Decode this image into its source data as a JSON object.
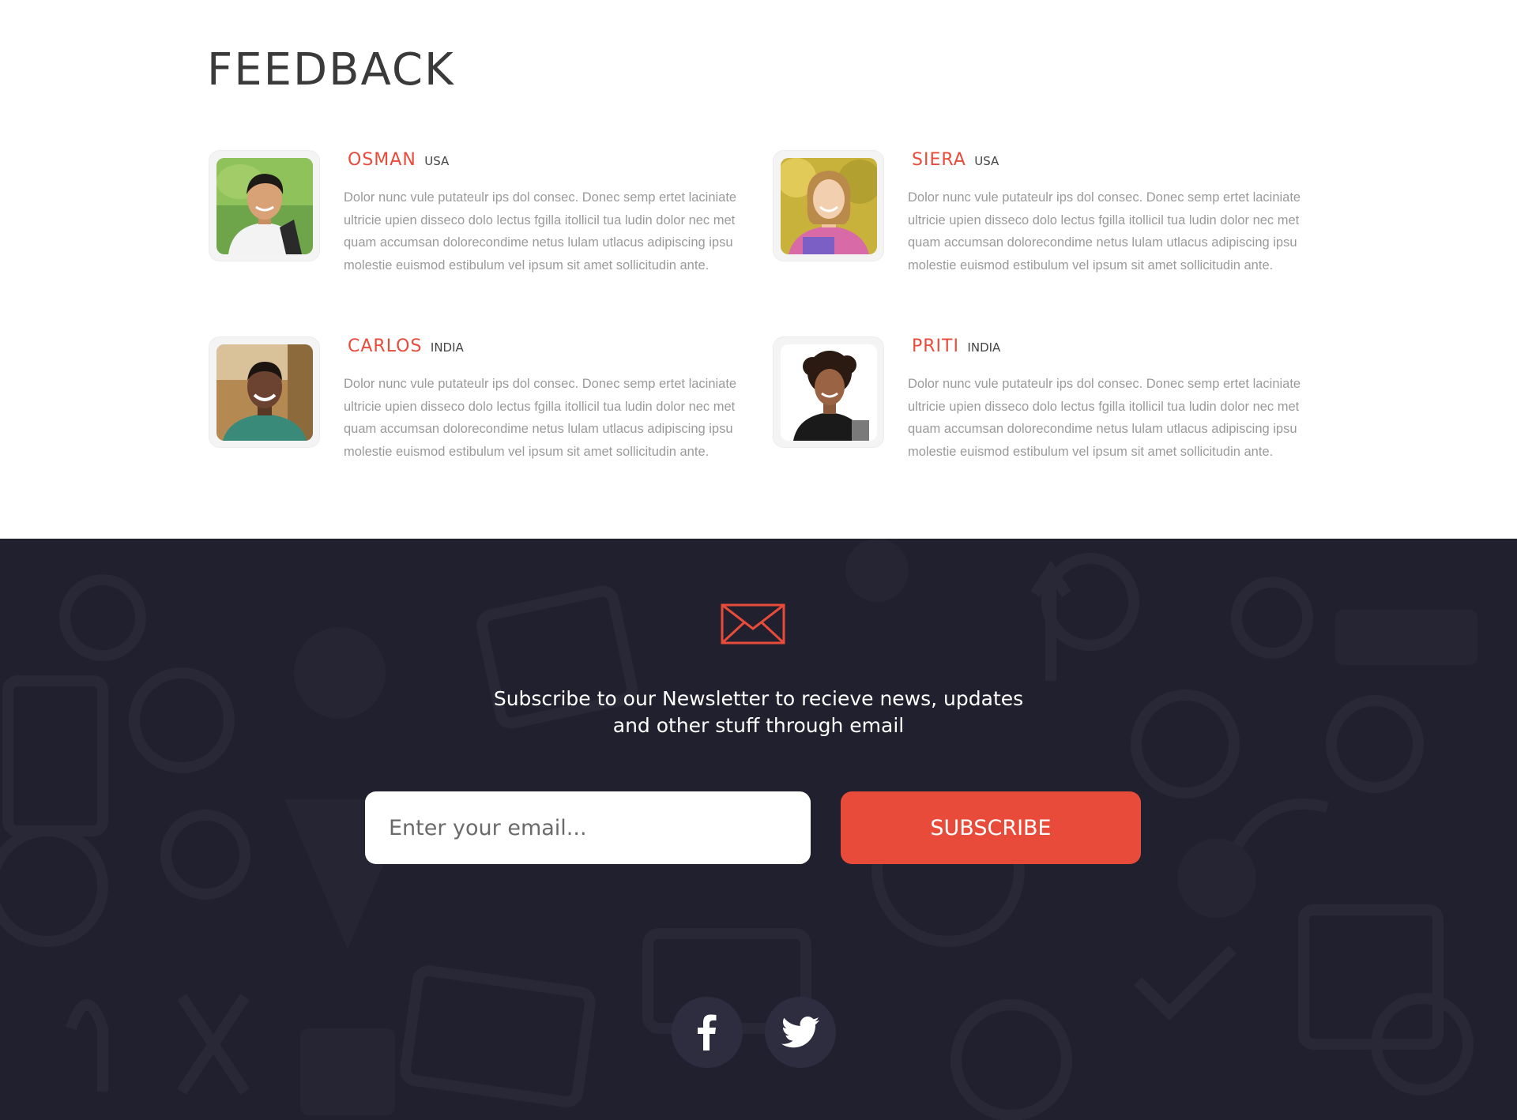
{
  "feedback": {
    "title": "FEEDBACK",
    "people": [
      {
        "name": "OSMAN",
        "country": "USA",
        "text": "Dolor nunc vule putateulr ips dol consec. Donec semp ertet laciniate ultricie upien disseco dolo lectus fgilla itollicil tua ludin dolor nec met quam accumsan dolorecondime netus lulam utlacus adipiscing ipsu molestie euismod estibulum vel ipsum sit amet sollicitudin ante."
      },
      {
        "name": "SIERA",
        "country": "USA",
        "text": "Dolor nunc vule putateulr ips dol consec. Donec semp ertet laciniate ultricie upien disseco dolo lectus fgilla itollicil tua ludin dolor nec met quam accumsan dolorecondime netus lulam utlacus adipiscing ipsu molestie euismod estibulum vel ipsum sit amet sollicitudin ante."
      },
      {
        "name": "CARLOS",
        "country": "INDIA",
        "text": "Dolor nunc vule putateulr ips dol consec. Donec semp ertet laciniate ultricie upien disseco dolo lectus fgilla itollicil tua ludin dolor nec met quam accumsan dolorecondime netus lulam utlacus adipiscing ipsu molestie euismod estibulum vel ipsum sit amet sollicitudin ante."
      },
      {
        "name": "PRITI",
        "country": "INDIA",
        "text": "Dolor nunc vule putateulr ips dol consec. Donec semp ertet laciniate ultricie upien disseco dolo lectus fgilla itollicil tua ludin dolor nec met quam accumsan dolorecondime netus lulam utlacus adipiscing ipsu molestie euismod estibulum vel ipsum sit amet sollicitudin ante."
      }
    ]
  },
  "newsletter": {
    "icon": "envelope-icon",
    "line1": "Subscribe to our Newsletter to recieve news,  updates",
    "line2": "and other stuff through email",
    "email_placeholder": "Enter your email...",
    "subscribe_label": "SUBSCRIBE"
  },
  "social": {
    "items": [
      "facebook-icon",
      "twitter-icon"
    ]
  },
  "colors": {
    "accent": "#e84b3a",
    "dark_bg": "#21202e",
    "social_bg": "#2e2d40",
    "body_text": "#9a9a9a"
  }
}
